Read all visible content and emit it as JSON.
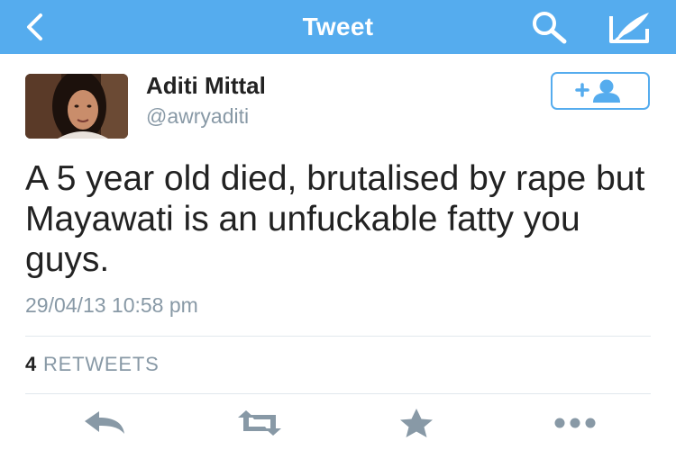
{
  "header": {
    "title": "Tweet",
    "back_icon": "chevron-left-icon",
    "search_icon": "search-icon",
    "compose_icon": "compose-icon",
    "background_color": "#55acee"
  },
  "tweet": {
    "author_name": "Aditi Mittal",
    "author_handle": "@awryaditi",
    "text": "A 5 year old died, brutalised by rape but Mayawati is an unfuckable fatty you guys.",
    "timestamp": "29/04/13 10:58 pm",
    "follow_icon": "add-user-icon"
  },
  "stats": {
    "retweet_count": "4",
    "retweet_label": "RETWEETS"
  },
  "actions": [
    {
      "name": "reply",
      "icon": "reply-icon"
    },
    {
      "name": "retweet",
      "icon": "retweet-icon"
    },
    {
      "name": "favorite",
      "icon": "star-icon"
    },
    {
      "name": "more",
      "icon": "more-icon"
    }
  ],
  "colors": {
    "accent": "#55acee",
    "text": "#222222",
    "muted": "#8899a6",
    "action_icons": "#8899a6"
  }
}
